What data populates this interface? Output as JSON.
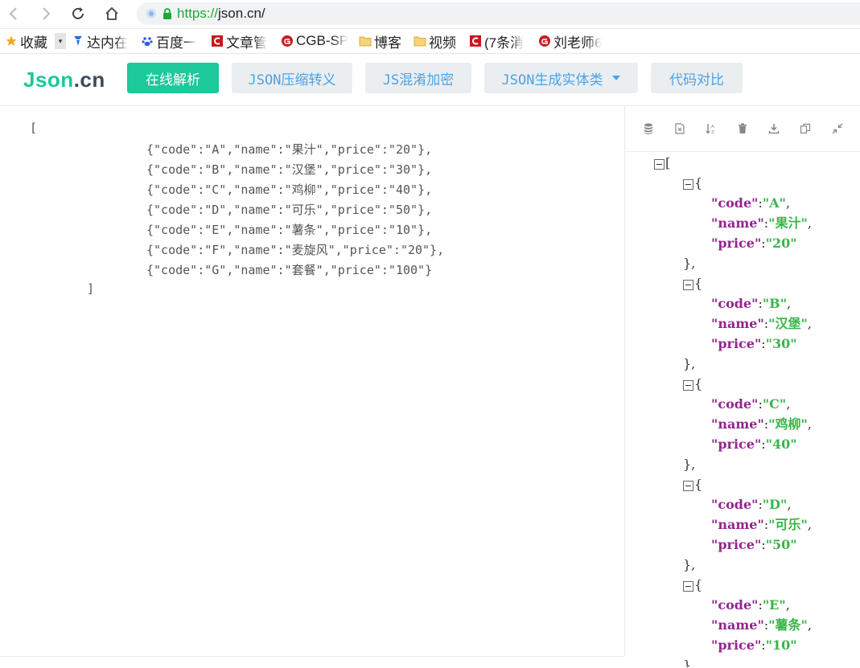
{
  "browser": {
    "url_scheme": "https://",
    "url_host": "json.cn/"
  },
  "bookmarks": [
    {
      "label": "收藏",
      "icon": "star-icon"
    },
    {
      "label": "达内在",
      "icon": "tarena-icon"
    },
    {
      "label": "百度一",
      "icon": "baidu-paw-icon"
    },
    {
      "label": "文章管",
      "icon": "csdn-icon"
    },
    {
      "label": "CGB-SP",
      "icon": "gitee-icon"
    },
    {
      "label": "博客",
      "icon": "folder-icon"
    },
    {
      "label": "视频",
      "icon": "folder-icon"
    },
    {
      "label": "(7条消",
      "icon": "csdn-icon"
    },
    {
      "label": "刘老师6",
      "icon": "gitee-icon"
    }
  ],
  "site": {
    "logo_a": "Json",
    "logo_b": ".cn",
    "nav": [
      {
        "label": "在线解析",
        "style": "primary"
      },
      {
        "label": "JSON压缩转义",
        "style": "secondary"
      },
      {
        "label": "JS混淆加密",
        "style": "secondary"
      },
      {
        "label": "JSON生成实体类",
        "style": "secondary",
        "dropdown": true
      },
      {
        "label": "代码对比",
        "style": "secondary"
      }
    ]
  },
  "editor": {
    "open": "[",
    "lines": [
      "{\"code\":\"A\",\"name\":\"果汁\",\"price\":\"20\"},",
      "{\"code\":\"B\",\"name\":\"汉堡\",\"price\":\"30\"},",
      "{\"code\":\"C\",\"name\":\"鸡柳\",\"price\":\"40\"},",
      "{\"code\":\"D\",\"name\":\"可乐\",\"price\":\"50\"},",
      "{\"code\":\"E\",\"name\":\"薯条\",\"price\":\"10\"},",
      "{\"code\":\"F\",\"name\":\"麦旋风\",\"price\":\"20\"},",
      "{\"code\":\"G\",\"name\":\"套餐\",\"price\":\"100\"}"
    ],
    "close": "]"
  },
  "toolbar": {
    "icons": [
      "database-icon",
      "export-file-icon",
      "sort-icon",
      "trash-icon",
      "download-icon",
      "copy-icon",
      "collapse-icon"
    ]
  },
  "tree": {
    "root_open": "[",
    "items": [
      {
        "code": "\"A\"",
        "name": "\"果汁\"",
        "price": "\"20\""
      },
      {
        "code": "\"B\"",
        "name": "\"汉堡\"",
        "price": "\"30\""
      },
      {
        "code": "\"C\"",
        "name": "\"鸡柳\"",
        "price": "\"40\""
      },
      {
        "code": "\"D\"",
        "name": "\"可乐\"",
        "price": "\"50\""
      },
      {
        "code": "\"E\"",
        "name": "\"薯条\"",
        "price": "\"10\""
      }
    ],
    "key_code": "\"code\"",
    "key_name": "\"name\"",
    "key_price": "\"price\"",
    "brace_open": "{",
    "brace_close": "},",
    "colon": ":",
    "comma": ","
  }
}
